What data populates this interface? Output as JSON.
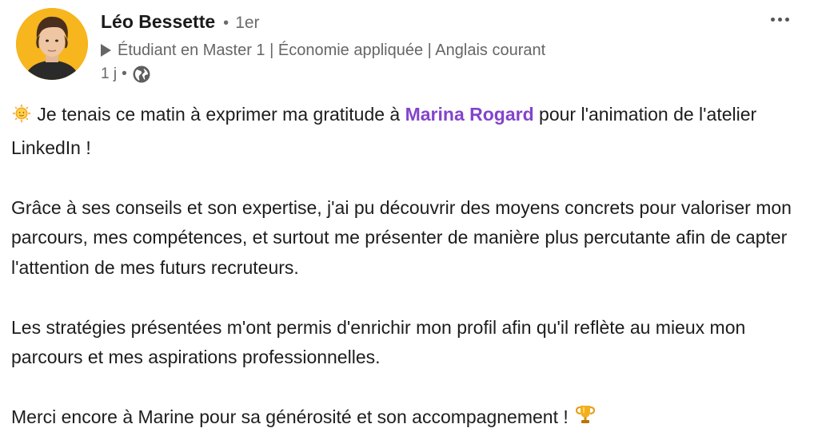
{
  "author": {
    "name": "Léo Bessette",
    "degree": "1er",
    "headline": "Étudiant en Master 1 | Économie appliquée | Anglais courant",
    "time": "1 j",
    "visibility_icon": "globe-icon",
    "avatar_bg": "#f7b51e"
  },
  "post": {
    "line1_before": " Je tenais ce matin à exprimer ma gratitude à ",
    "mention": "Marina Rogard",
    "line1_after": " pour l'animation de l'atelier LinkedIn !",
    "para2": "Grâce à ses conseils et son expertise, j'ai pu découvrir des moyens concrets pour valoriser mon parcours, mes compétences, et surtout me présenter de manière plus percutante afin de capter l'attention de mes futurs recruteurs.",
    "para3": "Les stratégies présentées m'ont permis d'enrichir mon profil afin qu'il reflète au mieux mon parcours et mes aspirations professionnelles.",
    "para4": "Merci encore à Marine pour sa générosité et son accompagnement ! ",
    "emoji_start": "sun-icon",
    "emoji_end": "trophy-icon",
    "mention_color": "#8344cc"
  },
  "menu": {
    "more_icon": "more-icon"
  }
}
